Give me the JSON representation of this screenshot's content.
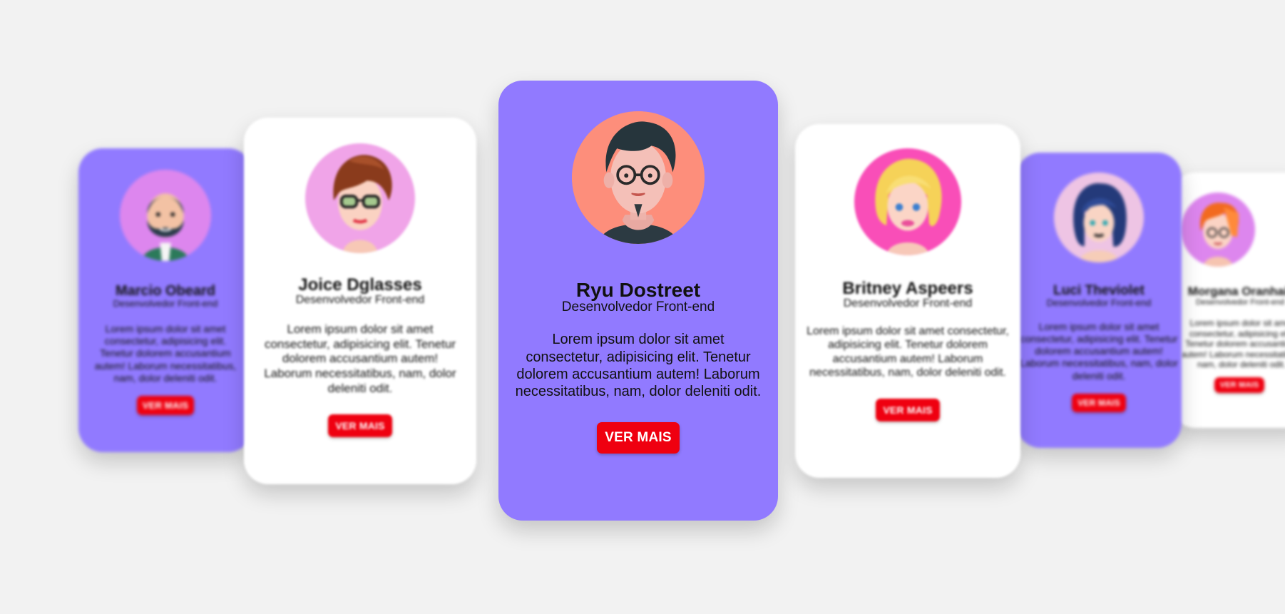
{
  "cards": [
    {
      "name": "Marcio Obeard",
      "role": "Desenvolvedor Front-end",
      "description": "Lorem ipsum dolor sit amet consectetur, adipisicing elit. Tenetur dolorem accusantium autem! Laborum necessitatibus, nam, dolor deleniti odit.",
      "button": "VER MAIS",
      "background": "#917aff",
      "avatar_color": "#dd86ee",
      "avatar_icon": "bearded-man-avatar"
    },
    {
      "name": "Joice Dglasses",
      "role": "Desenvolvedor Front-end",
      "description": "Lorem ipsum dolor sit amet consectetur, adipisicing elit. Tenetur dolorem accusantium autem! Laborum necessitatibus, nam, dolor deleniti odit.",
      "button": "VER MAIS",
      "background": "#ffffff",
      "avatar_color": "#f0a4e8",
      "avatar_icon": "woman-with-glasses-avatar"
    },
    {
      "name": "Ryu Dostreet",
      "role": "Desenvolvedor Front-end",
      "description": "Lorem ipsum dolor sit amet consectetur, adipisicing elit. Tenetur dolorem accusantium autem! Laborum necessitatibus, nam, dolor deleniti odit.",
      "button": "VER MAIS",
      "background": "#917aff",
      "avatar_color": "#fd8e7b",
      "avatar_icon": "man-with-glasses-avatar"
    },
    {
      "name": "Britney Aspeers",
      "role": "Desenvolvedor Front-end",
      "description": "Lorem ipsum dolor sit amet consectetur, adipisicing elit. Tenetur dolorem accusantium autem! Laborum necessitatibus, nam, dolor deleniti odit.",
      "button": "VER MAIS",
      "background": "#ffffff",
      "avatar_color": "#f94eb8",
      "avatar_icon": "blonde-woman-avatar"
    },
    {
      "name": "Luci Theviolet",
      "role": "Desenvolvedor Front-end",
      "description": "Lorem ipsum dolor sit amet consectetur, adipisicing elit. Tenetur dolorem accusantium autem! Laborum necessitatibus, nam, dolor deleniti odit.",
      "button": "VER MAIS",
      "background": "#917aff",
      "avatar_color": "#eec4e4",
      "avatar_icon": "blue-haired-woman-avatar"
    },
    {
      "name": "Morgana Oranhair",
      "role": "Desenvolvedor Front-end",
      "description": "Lorem ipsum dolor sit amet consectetur, adipisicing elit. Tenetur dolorem accusantium autem! Laborum necessitatibus, nam, dolor deleniti odit.",
      "button": "VER MAIS",
      "background": "#ffffff",
      "avatar_color": "#dd86ee",
      "avatar_icon": "orange-haired-woman-avatar"
    }
  ],
  "colors": {
    "page_background": "#f2f2f2",
    "accent_purple": "#917aff",
    "button_red": "#ef0010"
  }
}
